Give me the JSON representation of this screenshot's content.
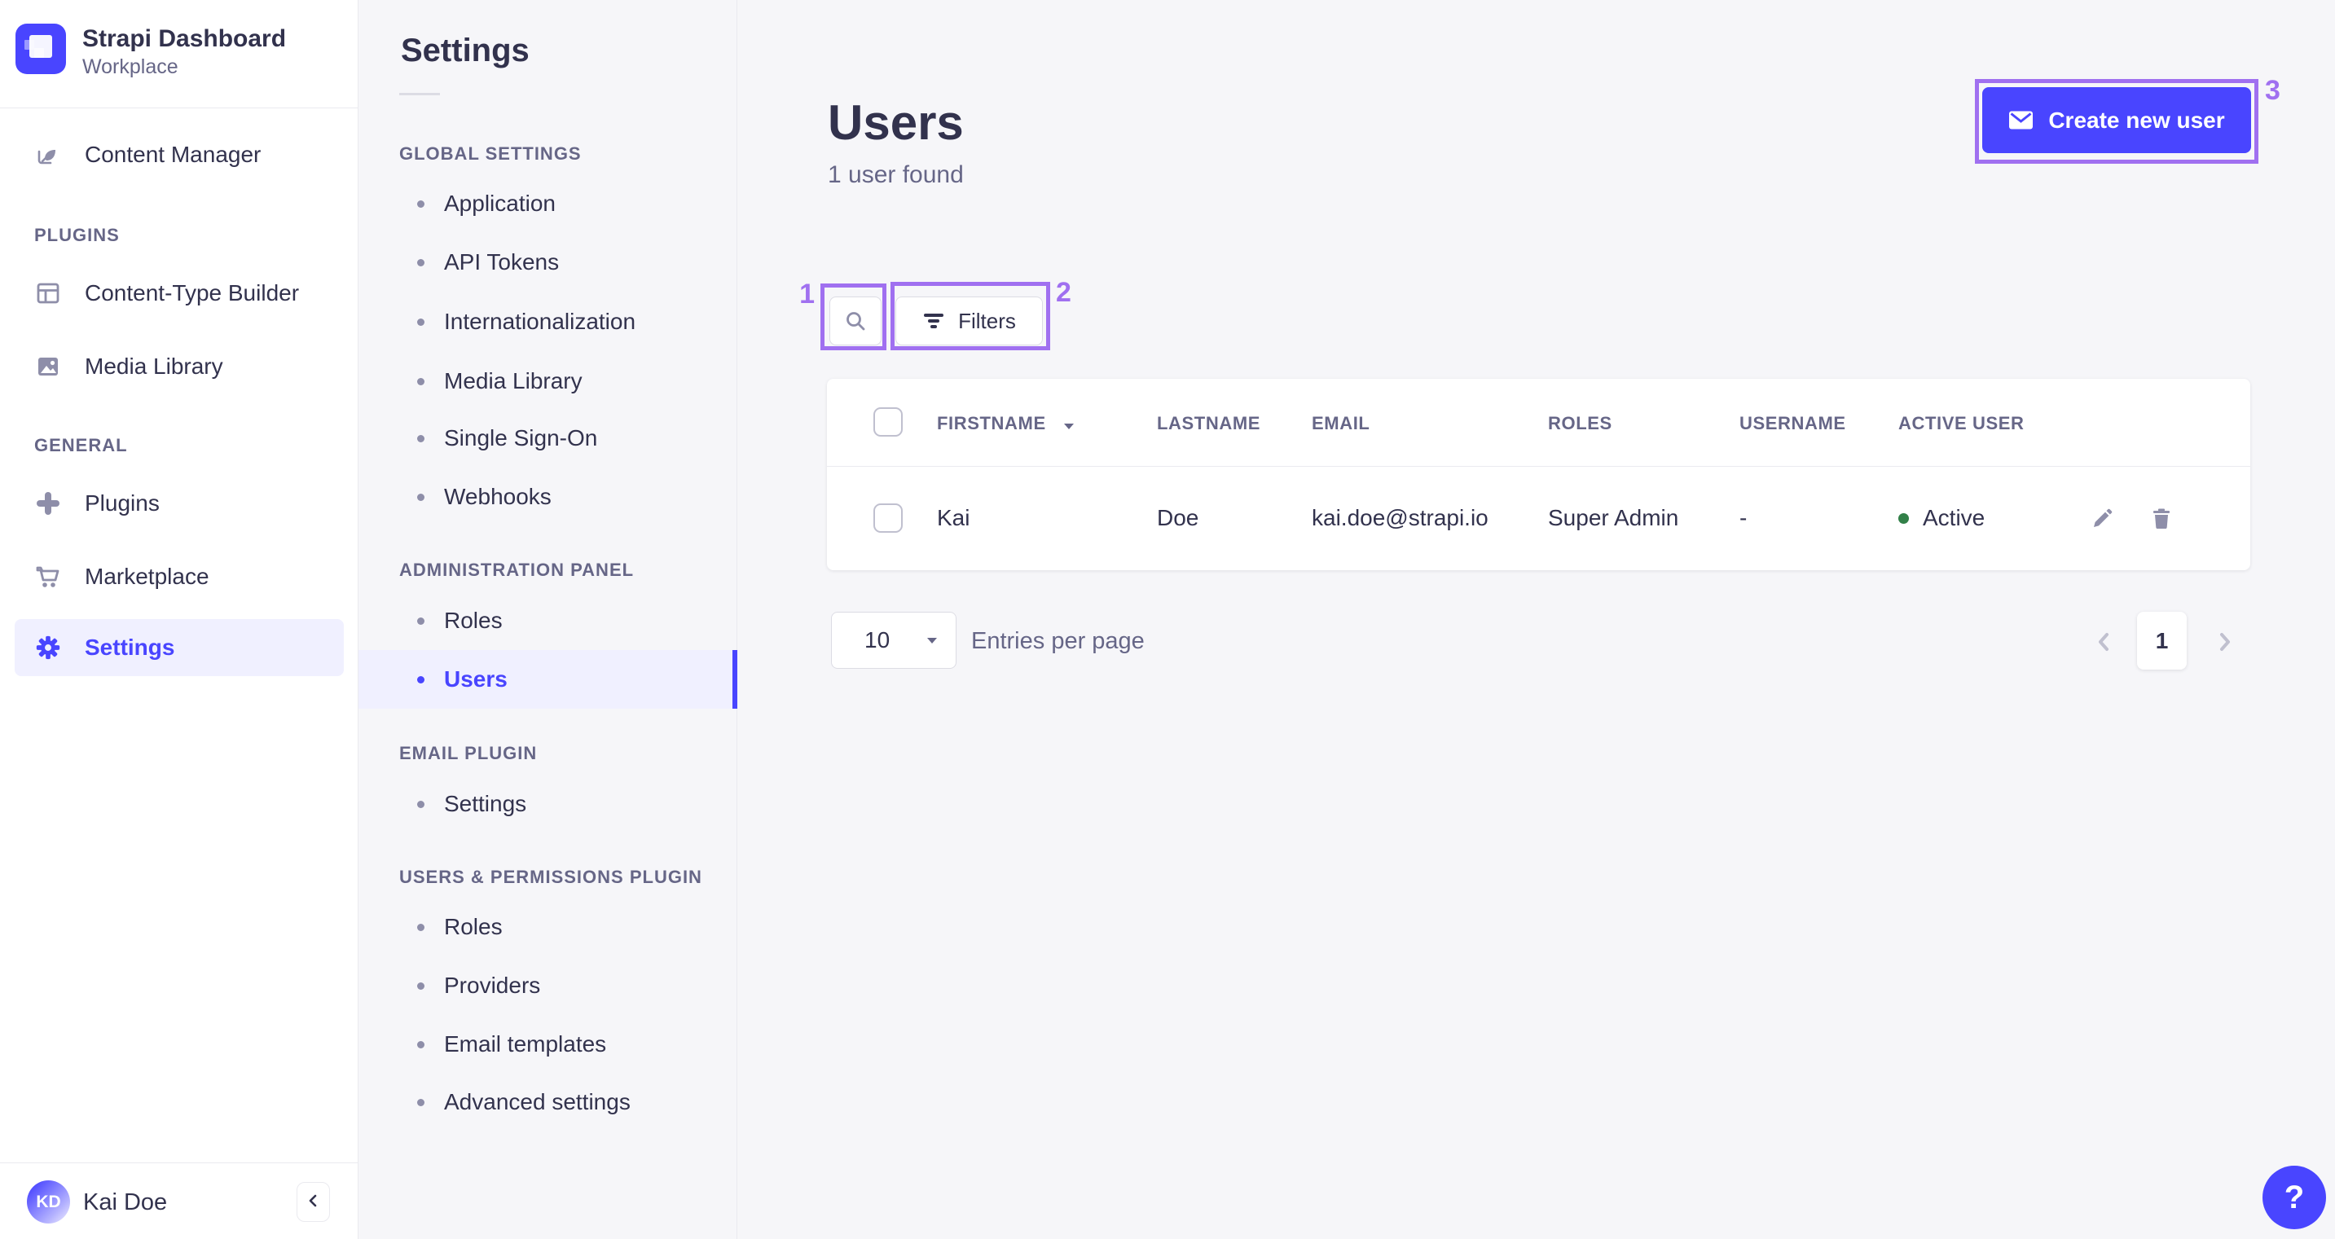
{
  "app": {
    "name": "Strapi Dashboard",
    "workplace": "Workplace"
  },
  "colors": {
    "primary": "#4945ff",
    "active_bg": "#f0f0ff",
    "annotation": "#a070f0",
    "success_dot": "#328048"
  },
  "main_nav": {
    "top_items": [
      {
        "label": "Content Manager",
        "icon": "feather-icon"
      }
    ],
    "sections": [
      {
        "label": "PLUGINS",
        "items": [
          {
            "label": "Content-Type Builder",
            "icon": "layout-icon"
          },
          {
            "label": "Media Library",
            "icon": "picture-icon"
          }
        ]
      },
      {
        "label": "GENERAL",
        "items": [
          {
            "label": "Plugins",
            "icon": "puzzle-icon"
          },
          {
            "label": "Marketplace",
            "icon": "cart-icon"
          },
          {
            "label": "Settings",
            "icon": "gear-icon",
            "active": true
          }
        ]
      }
    ],
    "user": {
      "initials": "KD",
      "name": "Kai Doe"
    }
  },
  "sub_nav": {
    "heading": "Settings",
    "sections": [
      {
        "label": "GLOBAL SETTINGS",
        "items": [
          "Application",
          "API Tokens",
          "Internationalization",
          "Media Library",
          "Single Sign-On",
          "Webhooks"
        ]
      },
      {
        "label": "ADMINISTRATION PANEL",
        "items": [
          "Roles",
          "Users"
        ],
        "active_item": "Users"
      },
      {
        "label": "EMAIL PLUGIN",
        "items": [
          "Settings"
        ]
      },
      {
        "label": "USERS & PERMISSIONS PLUGIN",
        "items": [
          "Roles",
          "Providers",
          "Email templates",
          "Advanced settings"
        ]
      }
    ]
  },
  "content": {
    "title": "Users",
    "subtitle": "1 user found",
    "create_button": "Create new user",
    "filters_button": "Filters",
    "table": {
      "headers": [
        "FIRSTNAME",
        "LASTNAME",
        "EMAIL",
        "ROLES",
        "USERNAME",
        "ACTIVE USER"
      ],
      "rows": [
        {
          "firstname": "Kai",
          "lastname": "Doe",
          "email": "kai.doe@strapi.io",
          "roles": "Super Admin",
          "username": "-",
          "active_status": "Active"
        }
      ]
    },
    "pagination": {
      "per_page": "10",
      "entries_label": "Entries per page",
      "page": "1"
    }
  },
  "annotations": [
    {
      "id": "1"
    },
    {
      "id": "2"
    },
    {
      "id": "3"
    }
  ],
  "help": {
    "label": "?"
  }
}
